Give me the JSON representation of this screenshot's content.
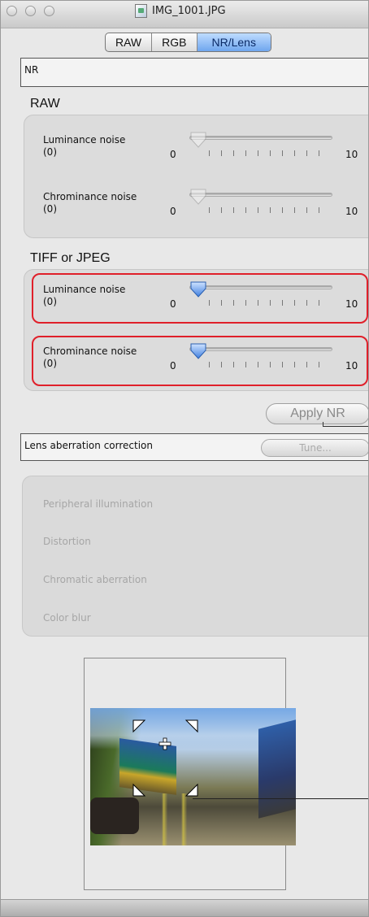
{
  "window": {
    "title": "IMG_1001.JPG"
  },
  "tabs": [
    {
      "label": "RAW",
      "active": false
    },
    {
      "label": "RGB",
      "active": false
    },
    {
      "label": "NR/Lens",
      "active": true
    }
  ],
  "nr": {
    "header": "NR",
    "raw": {
      "label": "RAW",
      "luminance": {
        "name": "Luminance noise",
        "value": "(0)",
        "min": "0",
        "max": "10",
        "level": 0
      },
      "chrominance": {
        "name": "Chrominance noise",
        "value": "(0)",
        "min": "0",
        "max": "10",
        "level": 0
      }
    },
    "tiff": {
      "label": "TIFF or JPEG",
      "luminance": {
        "name": "Luminance noise",
        "value": "(0)",
        "min": "0",
        "max": "10",
        "level": 0
      },
      "chrominance": {
        "name": "Chrominance noise",
        "value": "(0)",
        "min": "0",
        "max": "10",
        "level": 0
      }
    },
    "apply_label": "Apply NR"
  },
  "lens": {
    "header": "Lens aberration correction",
    "tune_label": "Tune...",
    "items": [
      "Peripheral illumination",
      "Distortion",
      "Chromatic aberration",
      "Color blur"
    ]
  },
  "colors": {
    "highlight": "#e0202a",
    "accent": "#6fa6ee"
  },
  "icons": {
    "file": "image-file-icon",
    "thumb": "slider-thumb-icon",
    "move": "crosshair-icon"
  }
}
